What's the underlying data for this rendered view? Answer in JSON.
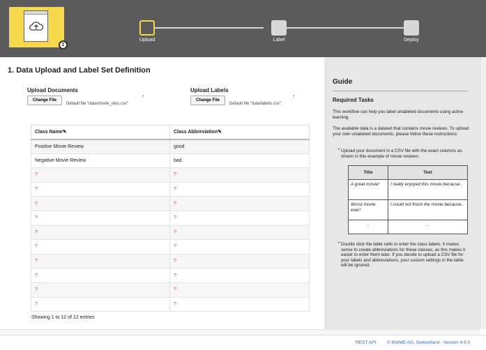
{
  "header": {
    "badge_number": "1",
    "steps": [
      {
        "label": "Upload"
      },
      {
        "label": "Label"
      },
      {
        "label": "Deploy"
      }
    ]
  },
  "main": {
    "title": "1. Data Upload and Label Set Definition",
    "upload_documents": {
      "label": "Upload Documents",
      "button": "Change File",
      "default_file": "Default file \"data/movie_revs.csv\"",
      "required": "*"
    },
    "upload_labels": {
      "label": "Upload Labels",
      "button": "Change File",
      "default_file": "Default file \"data/labels.csv\"",
      "required": "*"
    },
    "table": {
      "columns": [
        "Class Name",
        "Class Abbreviation"
      ],
      "rows": [
        [
          "Positive Movie Review",
          "good"
        ],
        [
          "Negative Movie Review",
          "bad"
        ],
        [
          "?",
          "?"
        ],
        [
          "?",
          "?"
        ],
        [
          "?",
          "?"
        ],
        [
          "?",
          "?"
        ],
        [
          "?",
          "?"
        ],
        [
          "?",
          "?"
        ],
        [
          "?",
          "?"
        ],
        [
          "?",
          "?"
        ],
        [
          "?",
          "?"
        ],
        [
          "?",
          "?"
        ]
      ],
      "info": "Showing 1 to 12 of 12 entries"
    }
  },
  "guide": {
    "title": "Guide",
    "subtitle": "Required Tasks",
    "p1": "This workflow can help you label unlabeled documents using active learning.",
    "p2": "The available data is a dataset that contains movie reviews. To upload your own unlabeled documents, please follow these instructions:",
    "li1": "Upload your document in a CSV file with the exact columns as shown in this example of movie reviews:",
    "example": {
      "headers": [
        "Title",
        "Text"
      ],
      "rows": [
        [
          "A great movie!",
          "I really enjoyed this movie because.."
        ],
        [
          "Worst movie ever!",
          "I could not finish the movie because.."
        ],
        [
          "...",
          "..."
        ]
      ]
    },
    "li2": "Double click the table cells to enter the class labels. It makes sense to create abbreviations for these classes, as this makes it easier to enter them later. If you decide to upload a CSV file for your labels and abbreviations, your custom settings in the table will be ignored."
  },
  "footer": {
    "rest_api": "REST API",
    "copyright": "© KNIME AG, Switzerland - Version 4.9.0"
  },
  "colors": {
    "header_bg": "#5b5b5b",
    "accent": "#f6d94a",
    "link": "#3a66c4",
    "placeholder": "#d44444"
  }
}
